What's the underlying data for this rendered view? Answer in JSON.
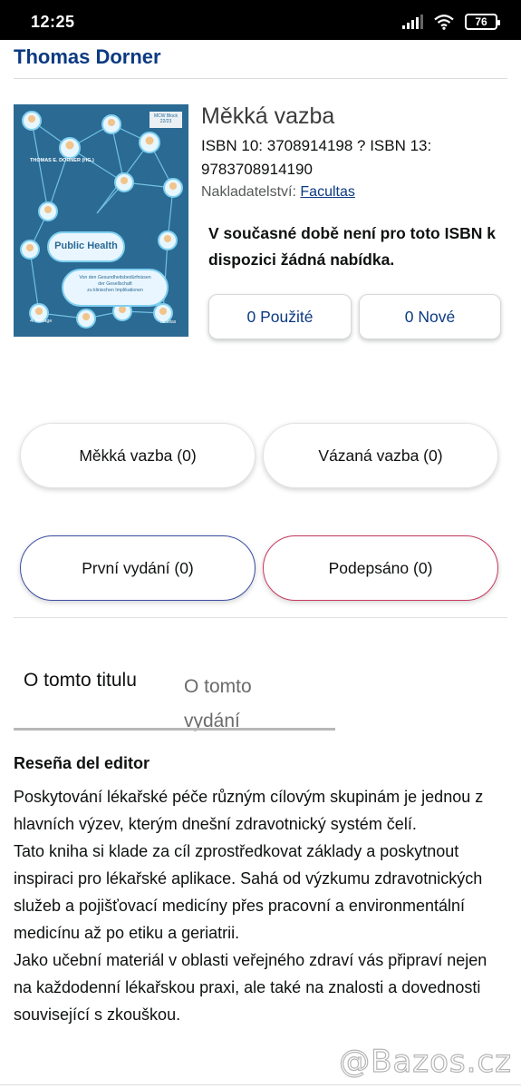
{
  "status_bar": {
    "time": "12:25",
    "battery": "76"
  },
  "header": {
    "author": "Thomas Dorner"
  },
  "book": {
    "binding": "Měkká vazba",
    "isbn_line1": "ISBN 10: 3708914198  ? ISBN 13:",
    "isbn_line2": "9783708914190",
    "publisher_label": "Nakladatelství:",
    "publisher_name": "Facultas",
    "no_offer": "V současné době není pro toto ISBN k dispozici žádná nabídka.",
    "cover": {
      "badge": "MCW Block 22/23",
      "editor": "THOMAS E. DORNER (HG.)",
      "title": "Public Health",
      "subtitle_lines": [
        "Von den Gesundheitsbedürfnissen",
        "der Gesellschaft",
        "zu klinischen Implikationen"
      ],
      "edition": "4. Auflage",
      "publisher": "facultas"
    }
  },
  "offers": {
    "used": "0 Použité",
    "new": "0 Nové"
  },
  "filters": {
    "softcover": "Měkká vazba (0)",
    "hardcover": "Vázaná vazba (0)",
    "first_edition": "První vydání (0)",
    "signed": "Podepsáno (0)"
  },
  "tabs": {
    "about_title": "O tomto titulu",
    "about_edition": "O tomto vydání"
  },
  "description": {
    "heading": "Reseña del editor",
    "paragraphs": [
      "Poskytování lékařské péče různým cílovým skupinám je jednou z hlavních výzev, kterým dnešní zdravotnický systém čelí.",
      "Tato kniha si klade za cíl zprostředkovat základy a poskytnout inspiraci pro lékařské aplikace. Sahá od výzkumu zdravotnických služeb a pojišťovací medicíny přes pracovní a environmentální medicínu až po etiku a geriatrii.",
      "Jako učební materiál v oblasti veřejného zdraví vás připraví nejen na každodenní lékařskou praxi, ale také na znalosti a dovednosti související s zkouškou."
    ]
  },
  "watermark": "@Bazos.cz",
  "colors": {
    "link_blue": "#0b3a82",
    "cover_blue": "#2a6a93",
    "signed_border": "#c8385d",
    "first_edition_border": "#3a4ea3"
  },
  "icons": [
    "signal-icon",
    "wifi-icon",
    "battery-icon"
  ]
}
